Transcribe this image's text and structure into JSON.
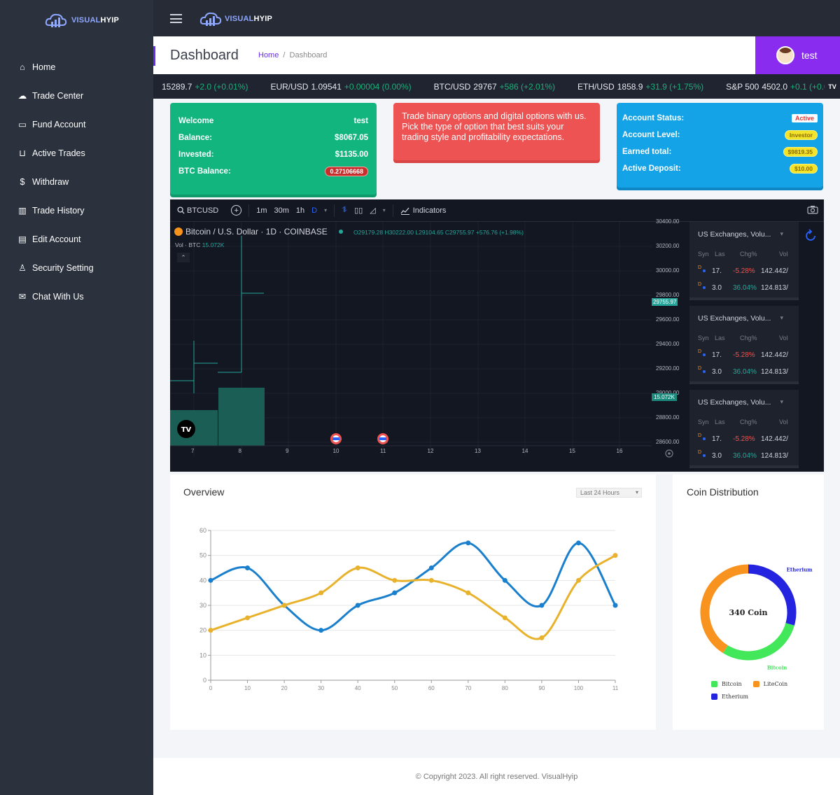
{
  "brand": {
    "name_prefix": "VISUAL",
    "name_suffix": "HYIP"
  },
  "sidebar": {
    "items": [
      {
        "label": "Home",
        "icon": "home-icon"
      },
      {
        "label": "Trade Center",
        "icon": "cloud-icon"
      },
      {
        "label": "Fund Account",
        "icon": "card-icon"
      },
      {
        "label": "Active Trades",
        "icon": "basket-icon"
      },
      {
        "label": "Withdraw",
        "icon": "dollar-icon"
      },
      {
        "label": "Trade History",
        "icon": "bar-chart-icon"
      },
      {
        "label": "Edit Account",
        "icon": "id-card-icon"
      },
      {
        "label": "Security Setting",
        "icon": "user-icon"
      },
      {
        "label": "Chat With Us",
        "icon": "mail-icon"
      }
    ]
  },
  "header": {
    "title": "Dashboard",
    "breadcrumb_home": "Home",
    "breadcrumb_sep": "/",
    "breadcrumb_current": "Dashboard",
    "user_name": "test"
  },
  "ticker": [
    {
      "symbol": "",
      "price": "15289.7",
      "change": "+2.0 (+0.01%)"
    },
    {
      "symbol": "EUR/USD",
      "price": "1.09541",
      "change": "+0.00004 (0.00%)"
    },
    {
      "symbol": "BTC/USD",
      "price": "29767",
      "change": "+586 (+2.01%)"
    },
    {
      "symbol": "ETH/USD",
      "price": "1858.9",
      "change": "+31.9 (+1.75%)"
    },
    {
      "symbol": "S&P 500",
      "price": "4502.0",
      "change": "+0.1 (+0.0"
    }
  ],
  "welcome_card": {
    "welcome_label": "Welcome",
    "welcome_value": "test",
    "balance_label": "Balance:",
    "balance_value": "$8067.05",
    "invested_label": "Invested:",
    "invested_value": "$1135.00",
    "btc_label": "BTC Balance:",
    "btc_value": "0.27106668"
  },
  "promo_card": {
    "text": "Trade binary options and digital options with us. Pick the type of option that best suits your trading style and profitability expectations."
  },
  "status_card": {
    "status_label": "Account Status:",
    "status_value": "Active",
    "level_label": "Account Level:",
    "level_value": "Investor",
    "earned_label": "Earned total:",
    "earned_value": "$9819.35",
    "deposit_label": "Active Deposit:",
    "deposit_value": "$10.00"
  },
  "tradingview": {
    "symbol": "BTCUSD",
    "intervals": [
      "1m",
      "30m",
      "1h",
      "D"
    ],
    "indicators_label": "Indicators",
    "pair_title": "Bitcoin / U.S. Dollar · 1D · COINBASE",
    "ohlc": "O29179.28 H30222.00 L29104.65 C29755.97 +576.76 (+1.98%)",
    "vol_label": "Vol · BTC",
    "vol_value": "15.072K",
    "price_tag": "29755.97",
    "vol_tag": "15.072K",
    "y_labels": [
      "30400.00",
      "30200.00",
      "30000.00",
      "29800.00",
      "29600.00",
      "29400.00",
      "29200.00",
      "29000.00",
      "28800.00",
      "28600.00"
    ],
    "x_labels": [
      "7",
      "8",
      "9",
      "10",
      "11",
      "12",
      "13",
      "14",
      "15",
      "16"
    ],
    "exchange_panels": [
      {
        "title": "US Exchanges, Volu...",
        "cols": [
          "Syn",
          "Las",
          "Chg%",
          "Vol"
        ],
        "rows": [
          {
            "last": "17.",
            "chg": "-5.28%",
            "vol": "142.442/"
          },
          {
            "last": "3.0",
            "chg": "36.04%",
            "vol": "124.813/"
          }
        ]
      },
      {
        "title": "US Exchanges, Volu...",
        "cols": [
          "Syn",
          "Las",
          "Chg%",
          "Vol"
        ],
        "rows": [
          {
            "last": "17.",
            "chg": "-5.28%",
            "vol": "142.442/"
          },
          {
            "last": "3.0",
            "chg": "36.04%",
            "vol": "124.813/"
          }
        ]
      },
      {
        "title": "US Exchanges, Volu...",
        "cols": [
          "Syn",
          "Las",
          "Chg%",
          "Vol"
        ],
        "rows": [
          {
            "last": "17.",
            "chg": "-5.28%",
            "vol": "142.442/"
          },
          {
            "last": "3.0",
            "chg": "36.04%",
            "vol": "124.813/"
          }
        ]
      }
    ]
  },
  "overview": {
    "title": "Overview",
    "range_select": "Last 24 Hours",
    "chart_data": {
      "type": "line",
      "x": [
        0,
        10,
        20,
        30,
        40,
        50,
        60,
        70,
        80,
        90,
        100,
        110
      ],
      "x_tick_labels": [
        "0",
        "10",
        "20",
        "30",
        "40",
        "50",
        "60",
        "70",
        "80",
        "90",
        "100",
        "11"
      ],
      "ylim": [
        0,
        60
      ],
      "y_ticks": [
        0,
        10,
        20,
        30,
        40,
        50,
        60
      ],
      "grid": true,
      "series": [
        {
          "values": [
            40,
            45,
            30,
            20,
            30,
            35,
            45,
            55,
            40,
            30,
            55,
            30
          ],
          "color": "#1a7fcc"
        },
        {
          "values": [
            20,
            25,
            30,
            35,
            45,
            40,
            40,
            35,
            25,
            17,
            40,
            50
          ],
          "color": "#e9b22c"
        }
      ]
    }
  },
  "coin_distribution": {
    "title": "Coin Distribution",
    "center_label": "340 Coin",
    "chart_data": {
      "type": "pie",
      "labels": [
        "Bitcoin",
        "LiteCoin",
        "Etherium"
      ],
      "values": [
        100,
        140,
        100
      ],
      "colors": [
        "#42e85a",
        "#f7931e",
        "#2323e0"
      ]
    }
  },
  "footer": {
    "text": "© Copyright 2023. All right reserved. VisualHyip"
  }
}
